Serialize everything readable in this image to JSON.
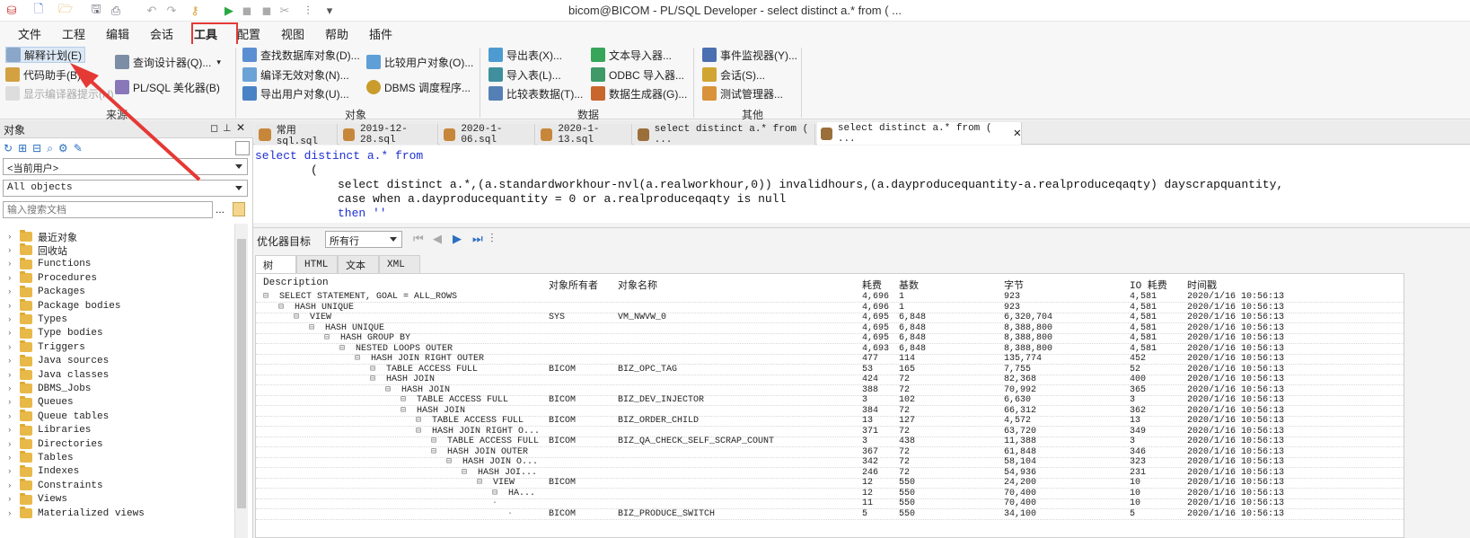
{
  "window": {
    "title": "bicom@BICOM - PL/SQL Developer - select distinct a.* from ( ..."
  },
  "menu": [
    "文件",
    "工程",
    "编辑",
    "会话",
    "工具",
    "配置",
    "视图",
    "帮助",
    "插件"
  ],
  "ribbon": {
    "source": {
      "items": [
        "解释计划(E)",
        "代码助手(B)",
        "显示编译器提示(H)",
        "查询设计器(Q)...",
        "PL/SQL 美化器(B)"
      ],
      "label": "来源"
    },
    "objects": {
      "items": [
        "查找数据库对象(D)...",
        "编译无效对象(N)...",
        "导出用户对象(U)...",
        "比较用户对象(O)...",
        "DBMS 调度程序..."
      ],
      "label": "对象"
    },
    "data": {
      "items": [
        "导出表(X)...",
        "导入表(L)...",
        "比较表数据(T)...",
        "文本导入器...",
        "ODBC 导入器...",
        "数据生成器(G)..."
      ],
      "label": "数据"
    },
    "other": {
      "items": [
        "事件监视器(Y)...",
        "会话(S)...",
        "测试管理器..."
      ],
      "label": "其他"
    }
  },
  "objects_panel": {
    "title": "对象",
    "owner": "<当前用户>",
    "filter": "All objects",
    "search_placeholder": "输入搜索文档",
    "search_btn": "...",
    "tree": [
      "最近对象",
      "回收站",
      "Functions",
      "Procedures",
      "Packages",
      "Package bodies",
      "Types",
      "Type bodies",
      "Triggers",
      "Java sources",
      "Java classes",
      "DBMS_Jobs",
      "Queues",
      "Queue tables",
      "Libraries",
      "Directories",
      "Tables",
      "Indexes",
      "Constraints",
      "Views",
      "Materialized views"
    ]
  },
  "tabs": [
    "常用sql.sql",
    "2019-12-28.sql",
    "2020-1-06.sql",
    "2020-1-13.sql",
    "select distinct a.* from ( ...",
    "select distinct a.* from ( ..."
  ],
  "editor": {
    "line1": "select distinct a.* from",
    "line2": "(",
    "line3": "select distinct a.*,(a.standardworkhour-nvl(a.realworkhour,0)) invalidhours,(a.dayproducequantity-a.realproduceqaqty) dayscrapquantity,",
    "line4": "case when a.dayproducequantity = 0 or a.realproduceqaqty is null",
    "line5": "then ''"
  },
  "plan": {
    "target_label": "优化器目标",
    "target_value": "所有行",
    "tabs": [
      "树",
      "HTML",
      "文本",
      "XML"
    ],
    "columns": [
      "Description",
      "对象所有者",
      "对象名称",
      "耗费",
      "基数",
      "字节",
      "IO 耗费",
      "时间戳"
    ],
    "rows": [
      {
        "d": "SELECT STATEMENT, GOAL = ALL_ROWS",
        "o": "",
        "n": "",
        "c": "4,696",
        "k": "1",
        "b": "923",
        "io": "4,581",
        "t": "2020/1/16 10:56:13"
      },
      {
        "d": "HASH UNIQUE",
        "o": "",
        "n": "",
        "c": "4,696",
        "k": "1",
        "b": "923",
        "io": "4,581",
        "t": "2020/1/16 10:56:13"
      },
      {
        "d": "VIEW",
        "o": "SYS",
        "n": "VM_NWVW_0",
        "c": "4,695",
        "k": "6,848",
        "b": "6,320,704",
        "io": "4,581",
        "t": "2020/1/16 10:56:13"
      },
      {
        "d": "HASH UNIQUE",
        "o": "",
        "n": "",
        "c": "4,695",
        "k": "6,848",
        "b": "8,388,800",
        "io": "4,581",
        "t": "2020/1/16 10:56:13"
      },
      {
        "d": "HASH GROUP BY",
        "o": "",
        "n": "",
        "c": "4,695",
        "k": "6,848",
        "b": "8,388,800",
        "io": "4,581",
        "t": "2020/1/16 10:56:13"
      },
      {
        "d": "NESTED LOOPS OUTER",
        "o": "",
        "n": "",
        "c": "4,693",
        "k": "6,848",
        "b": "8,388,800",
        "io": "4,581",
        "t": "2020/1/16 10:56:13"
      },
      {
        "d": "HASH JOIN RIGHT OUTER",
        "o": "",
        "n": "",
        "c": "477",
        "k": "114",
        "b": "135,774",
        "io": "452",
        "t": "2020/1/16 10:56:13"
      },
      {
        "d": "TABLE ACCESS FULL",
        "o": "BICOM",
        "n": "BIZ_OPC_TAG",
        "c": "53",
        "k": "165",
        "b": "7,755",
        "io": "52",
        "t": "2020/1/16 10:56:13"
      },
      {
        "d": "HASH JOIN",
        "o": "",
        "n": "",
        "c": "424",
        "k": "72",
        "b": "82,368",
        "io": "400",
        "t": "2020/1/16 10:56:13"
      },
      {
        "d": "HASH JOIN",
        "o": "",
        "n": "",
        "c": "388",
        "k": "72",
        "b": "70,992",
        "io": "365",
        "t": "2020/1/16 10:56:13"
      },
      {
        "d": "TABLE ACCESS FULL",
        "o": "BICOM",
        "n": "BIZ_DEV_INJECTOR",
        "c": "3",
        "k": "102",
        "b": "6,630",
        "io": "3",
        "t": "2020/1/16 10:56:13"
      },
      {
        "d": "HASH JOIN",
        "o": "",
        "n": "",
        "c": "384",
        "k": "72",
        "b": "66,312",
        "io": "362",
        "t": "2020/1/16 10:56:13"
      },
      {
        "d": "TABLE ACCESS FULL",
        "o": "BICOM",
        "n": "BIZ_ORDER_CHILD",
        "c": "13",
        "k": "127",
        "b": "4,572",
        "io": "13",
        "t": "2020/1/16 10:56:13"
      },
      {
        "d": "HASH JOIN RIGHT O...",
        "o": "",
        "n": "",
        "c": "371",
        "k": "72",
        "b": "63,720",
        "io": "349",
        "t": "2020/1/16 10:56:13"
      },
      {
        "d": "TABLE ACCESS FULL",
        "o": "BICOM",
        "n": "BIZ_QA_CHECK_SELF_SCRAP_COUNT",
        "c": "3",
        "k": "438",
        "b": "11,388",
        "io": "3",
        "t": "2020/1/16 10:56:13"
      },
      {
        "d": "HASH JOIN OUTER",
        "o": "",
        "n": "",
        "c": "367",
        "k": "72",
        "b": "61,848",
        "io": "346",
        "t": "2020/1/16 10:56:13"
      },
      {
        "d": "HASH JOIN O...",
        "o": "",
        "n": "",
        "c": "342",
        "k": "72",
        "b": "58,104",
        "io": "323",
        "t": "2020/1/16 10:56:13"
      },
      {
        "d": "HASH JOI...",
        "o": "",
        "n": "",
        "c": "246",
        "k": "72",
        "b": "54,936",
        "io": "231",
        "t": "2020/1/16 10:56:13"
      },
      {
        "d": "VIEW",
        "o": "BICOM",
        "n": "",
        "c": "12",
        "k": "550",
        "b": "24,200",
        "io": "10",
        "t": "2020/1/16 10:56:13"
      },
      {
        "d": "HA...",
        "o": "",
        "n": "",
        "c": "12",
        "k": "550",
        "b": "70,400",
        "io": "10",
        "t": "2020/1/16 10:56:13"
      },
      {
        "d": "",
        "o": "",
        "n": "",
        "c": "11",
        "k": "550",
        "b": "70,400",
        "io": "10",
        "t": "2020/1/16 10:56:13"
      },
      {
        "d": "",
        "o": "BICOM",
        "n": "BIZ_PRODUCE_SWITCH",
        "c": "5",
        "k": "550",
        "b": "34,100",
        "io": "5",
        "t": "2020/1/16 10:56:13"
      }
    ]
  },
  "colors": {
    "highlight": "#e53935",
    "keyword": "#1e2fd1",
    "folder": "#e8b949"
  }
}
